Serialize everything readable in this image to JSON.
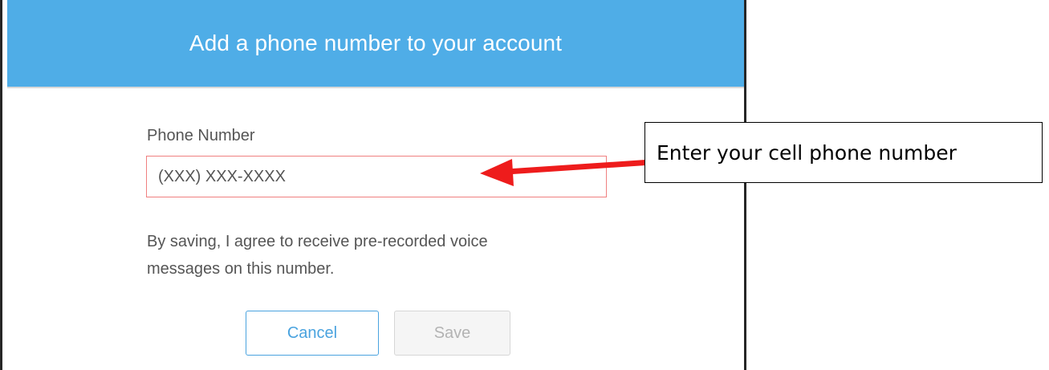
{
  "dialog": {
    "title": "Add a phone number to your account",
    "header_color": "#4fade7",
    "field_label": "Phone Number",
    "phone_placeholder": "(XXX) XXX-XXXX",
    "phone_value": "",
    "consent_line1": "By saving, I agree to receive pre-recorded voice",
    "consent_line2": "messages on this number.",
    "cancel_label": "Cancel",
    "save_label": "Save"
  },
  "annotation": {
    "text": "Enter your cell phone number",
    "arrow_color": "#ee1c1c"
  }
}
